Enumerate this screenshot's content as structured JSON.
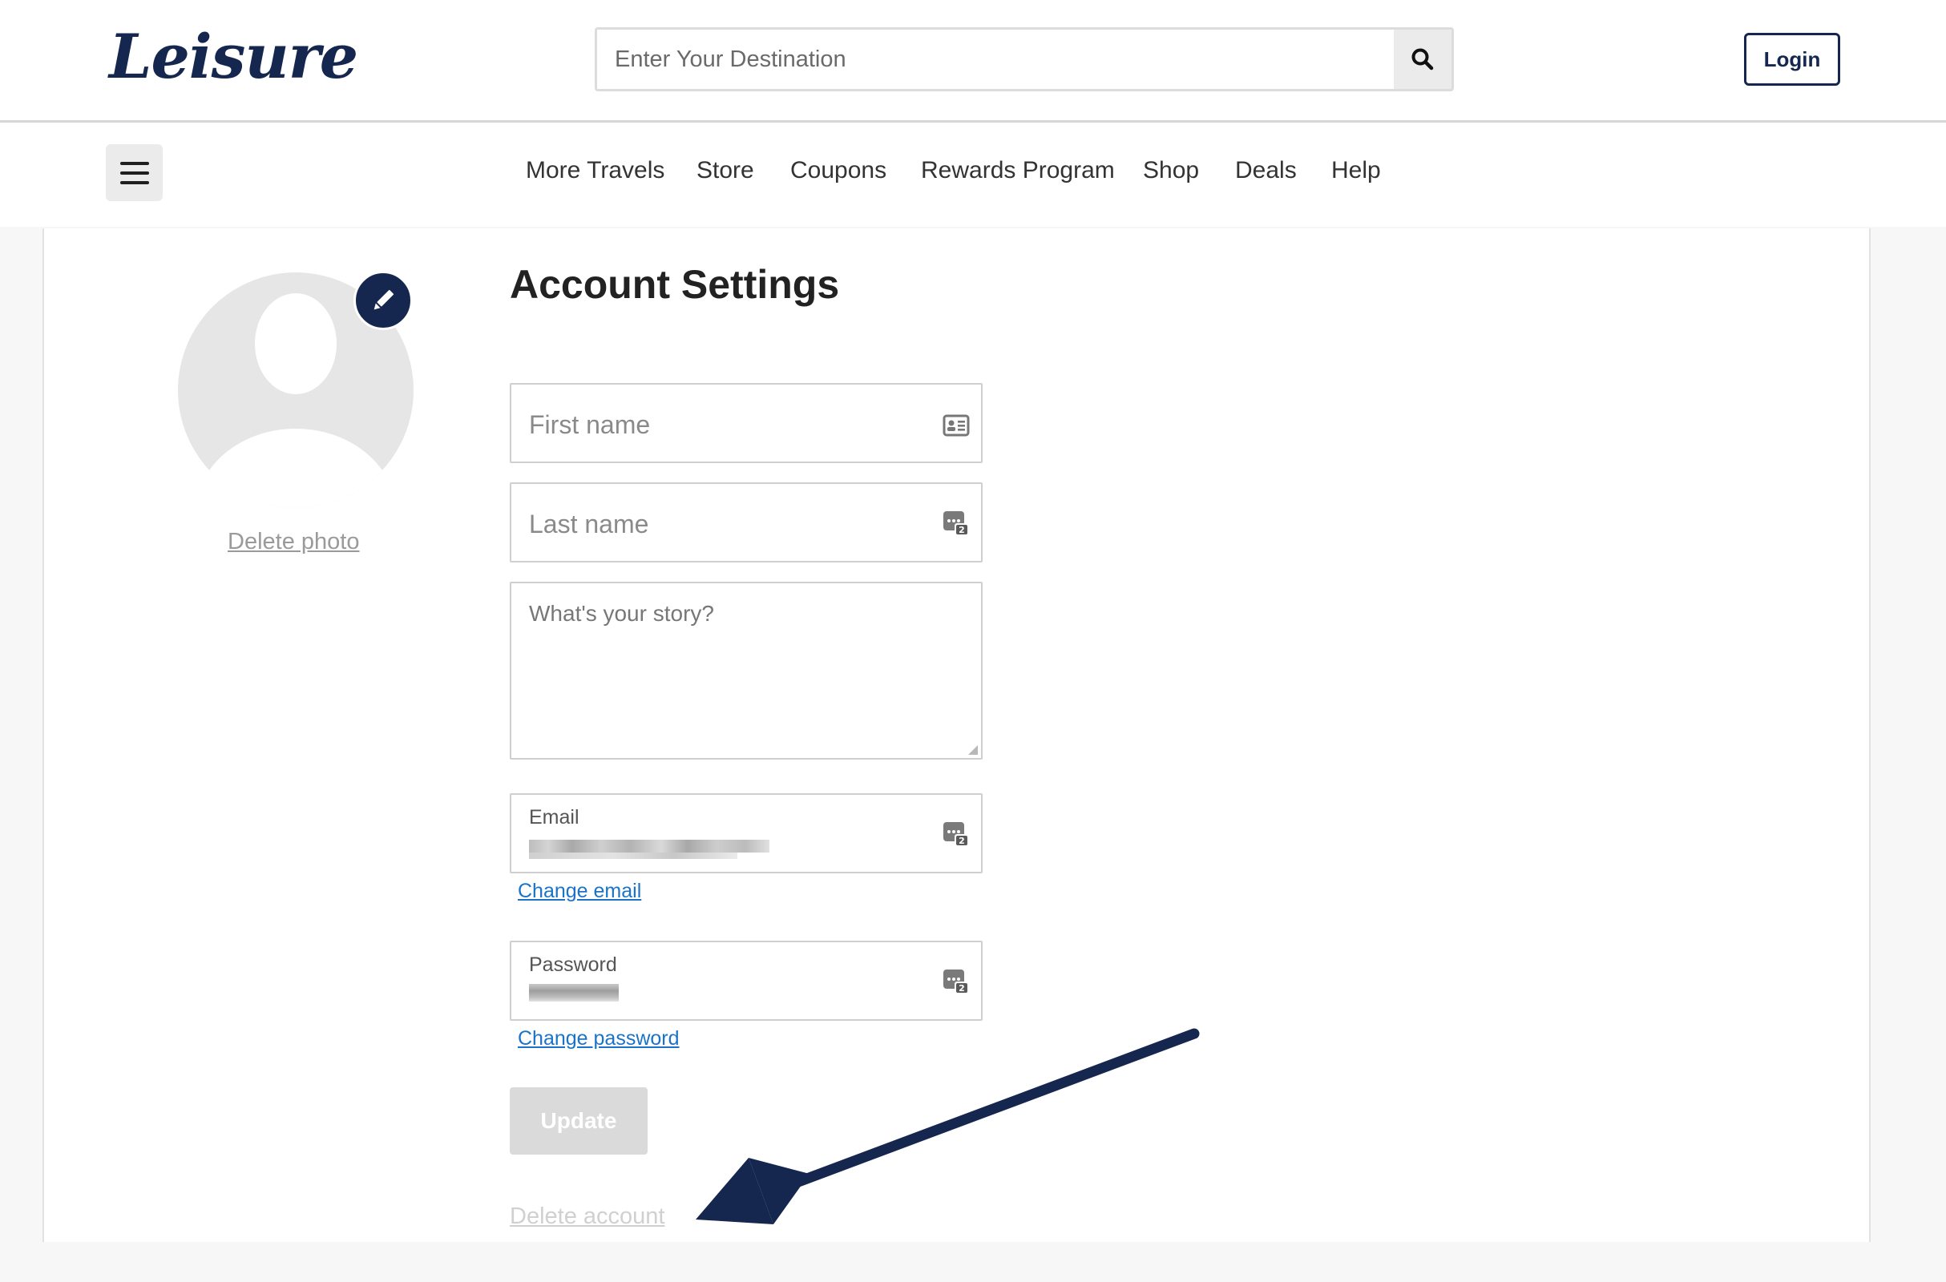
{
  "header": {
    "logo_text": "Leisure",
    "search_placeholder": "Enter Your Destination",
    "search_icon": "search-icon",
    "login_label": "Login"
  },
  "nav": {
    "menu_icon": "hamburger-icon",
    "links": [
      "More Travels",
      "Store",
      "Coupons",
      "Rewards Program",
      "Shop",
      "Deals",
      "Help"
    ]
  },
  "profile": {
    "edit_icon": "pencil-icon",
    "delete_photo_label": "Delete photo"
  },
  "form": {
    "title": "Account Settings",
    "first_name_placeholder": "First name",
    "last_name_placeholder": "Last name",
    "story_placeholder": "What's your story?",
    "email_label": "Email",
    "change_email_label": "Change email",
    "password_label": "Password",
    "change_password_label": "Change password",
    "update_label": "Update",
    "delete_account_label": "Delete account"
  },
  "colors": {
    "brand": "#15264f",
    "link": "#1a73c9",
    "disabled_button": "#dadada"
  }
}
